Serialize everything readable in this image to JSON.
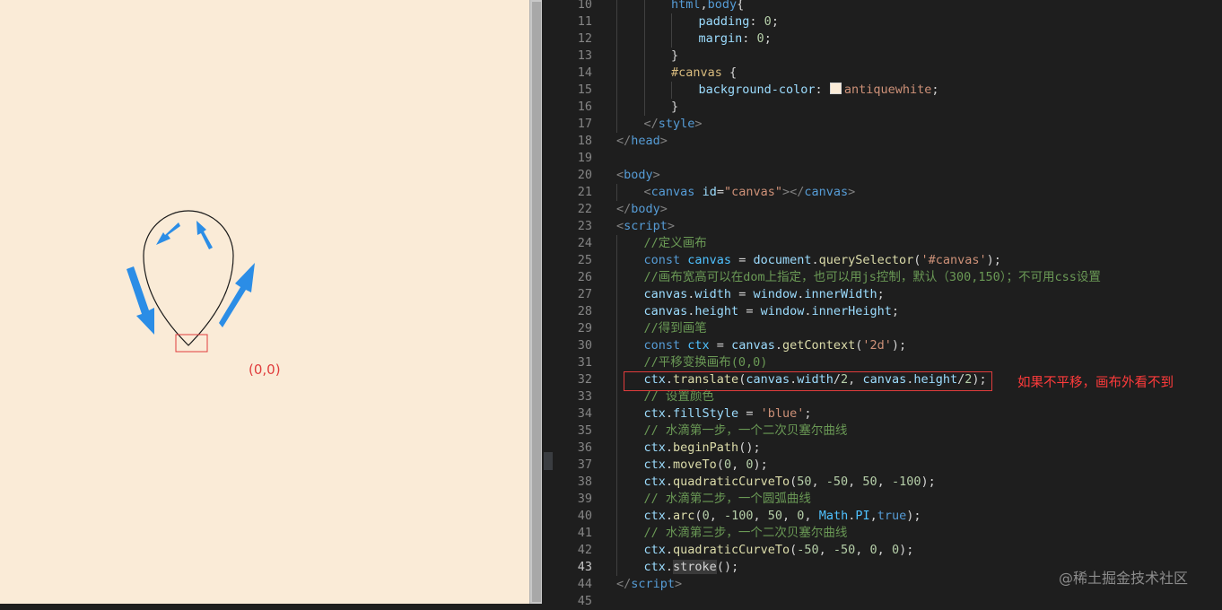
{
  "preview": {
    "origin_label": "(0,0)"
  },
  "editor": {
    "active_line": "43",
    "lines": [
      {
        "n": "10",
        "indent": 2,
        "tokens": [
          [
            "tag",
            "html"
          ],
          [
            "plain",
            ","
          ],
          [
            "tag",
            "body"
          ],
          [
            "plain",
            "{"
          ]
        ]
      },
      {
        "n": "11",
        "indent": 3,
        "tokens": [
          [
            "prop",
            "padding"
          ],
          [
            "plain",
            ": "
          ],
          [
            "num",
            "0"
          ],
          [
            "plain",
            ";"
          ]
        ]
      },
      {
        "n": "12",
        "indent": 3,
        "tokens": [
          [
            "prop",
            "margin"
          ],
          [
            "plain",
            ": "
          ],
          [
            "num",
            "0"
          ],
          [
            "plain",
            ";"
          ]
        ]
      },
      {
        "n": "13",
        "indent": 2,
        "tokens": [
          [
            "plain",
            "}"
          ]
        ]
      },
      {
        "n": "14",
        "indent": 2,
        "tokens": [
          [
            "sel",
            "#canvas"
          ],
          [
            "plain",
            " {"
          ]
        ]
      },
      {
        "n": "15",
        "indent": 3,
        "tokens": [
          [
            "prop",
            "background-color"
          ],
          [
            "plain",
            ": "
          ],
          [
            "swatch",
            ""
          ],
          [
            "str",
            "antiquewhite"
          ],
          [
            "plain",
            ";"
          ]
        ]
      },
      {
        "n": "16",
        "indent": 2,
        "tokens": [
          [
            "plain",
            "}"
          ]
        ]
      },
      {
        "n": "17",
        "indent": 1,
        "tokens": [
          [
            "punc",
            "</"
          ],
          [
            "tag",
            "style"
          ],
          [
            "punc",
            ">"
          ]
        ]
      },
      {
        "n": "18",
        "indent": 0,
        "tokens": [
          [
            "punc",
            "</"
          ],
          [
            "tag",
            "head"
          ],
          [
            "punc",
            ">"
          ]
        ]
      },
      {
        "n": "19",
        "indent": 0,
        "tokens": []
      },
      {
        "n": "20",
        "indent": 0,
        "tokens": [
          [
            "punc",
            "<"
          ],
          [
            "tag",
            "body"
          ],
          [
            "punc",
            ">"
          ]
        ]
      },
      {
        "n": "21",
        "indent": 1,
        "tokens": [
          [
            "punc",
            "<"
          ],
          [
            "tag",
            "canvas"
          ],
          [
            "plain",
            " "
          ],
          [
            "attr",
            "id"
          ],
          [
            "plain",
            "="
          ],
          [
            "str",
            "\"canvas\""
          ],
          [
            "punc",
            "></"
          ],
          [
            "tag",
            "canvas"
          ],
          [
            "punc",
            ">"
          ]
        ]
      },
      {
        "n": "22",
        "indent": 0,
        "tokens": [
          [
            "punc",
            "</"
          ],
          [
            "tag",
            "body"
          ],
          [
            "punc",
            ">"
          ]
        ]
      },
      {
        "n": "23",
        "indent": 0,
        "tokens": [
          [
            "punc",
            "<"
          ],
          [
            "tag",
            "script"
          ],
          [
            "punc",
            ">"
          ]
        ]
      },
      {
        "n": "24",
        "indent": 1,
        "tokens": [
          [
            "com",
            "//定义画布"
          ]
        ]
      },
      {
        "n": "25",
        "indent": 1,
        "tokens": [
          [
            "kw",
            "const"
          ],
          [
            "plain",
            " "
          ],
          [
            "var",
            "canvas"
          ],
          [
            "plain",
            " = "
          ],
          [
            "prop",
            "document"
          ],
          [
            "plain",
            "."
          ],
          [
            "fn",
            "querySelector"
          ],
          [
            "plain",
            "("
          ],
          [
            "str",
            "'#canvas'"
          ],
          [
            "plain",
            ");"
          ]
        ]
      },
      {
        "n": "26",
        "indent": 1,
        "tokens": [
          [
            "com",
            "//画布宽高可以在dom上指定，也可以用js控制，默认（300,150）；不可用css设置"
          ]
        ]
      },
      {
        "n": "27",
        "indent": 1,
        "tokens": [
          [
            "prop",
            "canvas"
          ],
          [
            "plain",
            "."
          ],
          [
            "prop",
            "width"
          ],
          [
            "plain",
            " = "
          ],
          [
            "prop",
            "window"
          ],
          [
            "plain",
            "."
          ],
          [
            "prop",
            "innerWidth"
          ],
          [
            "plain",
            ";"
          ]
        ]
      },
      {
        "n": "28",
        "indent": 1,
        "tokens": [
          [
            "prop",
            "canvas"
          ],
          [
            "plain",
            "."
          ],
          [
            "prop",
            "height"
          ],
          [
            "plain",
            " = "
          ],
          [
            "prop",
            "window"
          ],
          [
            "plain",
            "."
          ],
          [
            "prop",
            "innerHeight"
          ],
          [
            "plain",
            ";"
          ]
        ]
      },
      {
        "n": "29",
        "indent": 1,
        "tokens": [
          [
            "com",
            "//得到画笔"
          ]
        ]
      },
      {
        "n": "30",
        "indent": 1,
        "tokens": [
          [
            "kw",
            "const"
          ],
          [
            "plain",
            " "
          ],
          [
            "var",
            "ctx"
          ],
          [
            "plain",
            " = "
          ],
          [
            "prop",
            "canvas"
          ],
          [
            "plain",
            "."
          ],
          [
            "fn",
            "getContext"
          ],
          [
            "plain",
            "("
          ],
          [
            "str",
            "'2d'"
          ],
          [
            "plain",
            ");"
          ]
        ]
      },
      {
        "n": "31",
        "indent": 1,
        "tokens": [
          [
            "com",
            "//平移变换画布(0,0)"
          ]
        ]
      },
      {
        "n": "32",
        "indent": 1,
        "tokens": [
          [
            "prop",
            "ctx"
          ],
          [
            "plain",
            "."
          ],
          [
            "fn",
            "translate"
          ],
          [
            "plain",
            "("
          ],
          [
            "prop",
            "canvas"
          ],
          [
            "plain",
            "."
          ],
          [
            "prop",
            "width"
          ],
          [
            "plain",
            "/"
          ],
          [
            "num",
            "2"
          ],
          [
            "plain",
            ", "
          ],
          [
            "prop",
            "canvas"
          ],
          [
            "plain",
            "."
          ],
          [
            "prop",
            "height"
          ],
          [
            "plain",
            "/"
          ],
          [
            "num",
            "2"
          ],
          [
            "plain",
            ");"
          ]
        ]
      },
      {
        "n": "33",
        "indent": 1,
        "tokens": [
          [
            "com",
            "// 设置颜色"
          ]
        ]
      },
      {
        "n": "34",
        "indent": 1,
        "tokens": [
          [
            "prop",
            "ctx"
          ],
          [
            "plain",
            "."
          ],
          [
            "prop",
            "fillStyle"
          ],
          [
            "plain",
            " = "
          ],
          [
            "str",
            "'blue'"
          ],
          [
            "plain",
            ";"
          ]
        ]
      },
      {
        "n": "35",
        "indent": 1,
        "tokens": [
          [
            "com",
            "// 水滴第一步，一个二次贝塞尔曲线"
          ]
        ]
      },
      {
        "n": "36",
        "indent": 1,
        "tokens": [
          [
            "prop",
            "ctx"
          ],
          [
            "plain",
            "."
          ],
          [
            "fn",
            "beginPath"
          ],
          [
            "plain",
            "();"
          ]
        ]
      },
      {
        "n": "37",
        "indent": 1,
        "tokens": [
          [
            "prop",
            "ctx"
          ],
          [
            "plain",
            "."
          ],
          [
            "fn",
            "moveTo"
          ],
          [
            "plain",
            "("
          ],
          [
            "num",
            "0"
          ],
          [
            "plain",
            ", "
          ],
          [
            "num",
            "0"
          ],
          [
            "plain",
            ");"
          ]
        ]
      },
      {
        "n": "38",
        "indent": 1,
        "tokens": [
          [
            "prop",
            "ctx"
          ],
          [
            "plain",
            "."
          ],
          [
            "fn",
            "quadraticCurveTo"
          ],
          [
            "plain",
            "("
          ],
          [
            "num",
            "50"
          ],
          [
            "plain",
            ", "
          ],
          [
            "num",
            "-50"
          ],
          [
            "plain",
            ", "
          ],
          [
            "num",
            "50"
          ],
          [
            "plain",
            ", "
          ],
          [
            "num",
            "-100"
          ],
          [
            "plain",
            ");"
          ]
        ]
      },
      {
        "n": "39",
        "indent": 1,
        "tokens": [
          [
            "com",
            "// 水滴第二步，一个圆弧曲线"
          ]
        ]
      },
      {
        "n": "40",
        "indent": 1,
        "tokens": [
          [
            "prop",
            "ctx"
          ],
          [
            "plain",
            "."
          ],
          [
            "fn",
            "arc"
          ],
          [
            "plain",
            "("
          ],
          [
            "num",
            "0"
          ],
          [
            "plain",
            ", "
          ],
          [
            "num",
            "-100"
          ],
          [
            "plain",
            ", "
          ],
          [
            "num",
            "50"
          ],
          [
            "plain",
            ", "
          ],
          [
            "num",
            "0"
          ],
          [
            "plain",
            ", "
          ],
          [
            "const",
            "Math"
          ],
          [
            "plain",
            "."
          ],
          [
            "const",
            "PI"
          ],
          [
            "plain",
            ","
          ],
          [
            "kw",
            "true"
          ],
          [
            "plain",
            ");"
          ]
        ]
      },
      {
        "n": "41",
        "indent": 1,
        "tokens": [
          [
            "com",
            "// 水滴第三步，一个二次贝塞尔曲线"
          ]
        ]
      },
      {
        "n": "42",
        "indent": 1,
        "tokens": [
          [
            "prop",
            "ctx"
          ],
          [
            "plain",
            "."
          ],
          [
            "fn",
            "quadraticCurveTo"
          ],
          [
            "plain",
            "("
          ],
          [
            "num",
            "-50"
          ],
          [
            "plain",
            ", "
          ],
          [
            "num",
            "-50"
          ],
          [
            "plain",
            ", "
          ],
          [
            "num",
            "0"
          ],
          [
            "plain",
            ", "
          ],
          [
            "num",
            "0"
          ],
          [
            "plain",
            ");"
          ]
        ]
      },
      {
        "n": "43",
        "indent": 1,
        "tokens": [
          [
            "prop",
            "ctx"
          ],
          [
            "plain",
            "."
          ],
          [
            "hl",
            "stroke"
          ],
          [
            "plain",
            "();"
          ]
        ]
      },
      {
        "n": "44",
        "indent": 0,
        "tokens": [
          [
            "punc",
            "</"
          ],
          [
            "tag",
            "script"
          ],
          [
            "punc",
            ">"
          ]
        ]
      },
      {
        "n": "45",
        "indent": 0,
        "tokens": []
      }
    ]
  },
  "annotation": "如果不平移，画布外看不到",
  "watermark": "@稀土掘金技术社区",
  "colors": {
    "canvas_bg": "#faebd7",
    "editor_bg": "#1e1e1e",
    "arrow_blue": "#2b8de6",
    "annotation_red": "#ff3b3b"
  }
}
